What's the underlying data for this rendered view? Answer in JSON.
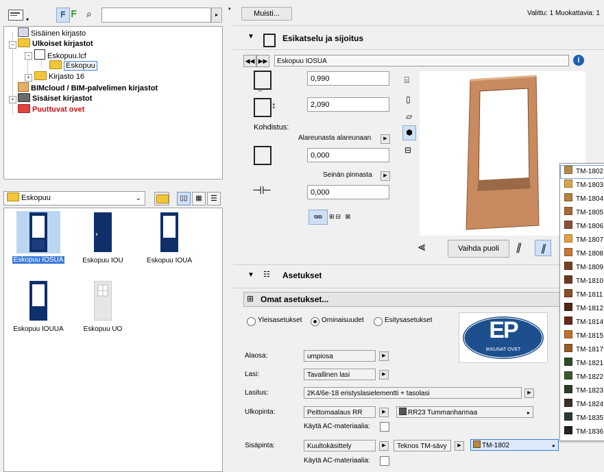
{
  "toolbar": {
    "search_placeholder": "",
    "muisti_button": "Muisti...",
    "status_text": "Valittu: 1 Muokattavia: 1"
  },
  "tree": {
    "items": [
      {
        "label": "Sisäinen kirjasto"
      },
      {
        "label": "Ulkoiset kirjastot"
      },
      {
        "label": "Eskopuu.lcf"
      },
      {
        "label": "Eskopuu"
      },
      {
        "label": "Kirjasto 16"
      },
      {
        "label": "BIMcloud / BIM-palvelimen kirjastot"
      },
      {
        "label": "Sisäiset kirjastot"
      },
      {
        "label": "Puuttuvat ovet"
      }
    ]
  },
  "folder_dropdown": {
    "value": "Eskopuu"
  },
  "thumbnails": [
    {
      "label": "Eskopuu IOSUA"
    },
    {
      "label": "Eskopuu IOU"
    },
    {
      "label": "Eskopuu IOUA"
    },
    {
      "label": "Eskopuu IOUUA"
    },
    {
      "label": "Eskopuu UO"
    }
  ],
  "preview": {
    "section_title": "Esikatselu ja sijoitus",
    "object_name": "Eskopuu IOSUA",
    "width": "0,990",
    "height": "2,090",
    "kohdistus_label": "Kohdistus:",
    "anchor_label": "Alareunasta alareunaan",
    "anchor_value": "0,000",
    "wall_label": "Seinän pinnasta",
    "wall_value": "0,000",
    "flip_button": "Vaihda puoli"
  },
  "settings": {
    "section_title": "Asetukset",
    "own_settings": "Omat asetukset...",
    "radios": [
      {
        "label": "Yleisasetukset",
        "checked": false
      },
      {
        "label": "Ominaisuudet",
        "checked": true
      },
      {
        "label": "Esitysasetukset",
        "checked": false
      }
    ],
    "logo_text": "EP",
    "logo_sub": "IKKUNAT OVET",
    "rows": {
      "alaosa_label": "Alaosa:",
      "alaosa_value": "umpiosa",
      "lasi_label": "Lasi:",
      "lasi_value": "Tavallinen lasi",
      "lasitus_label": "Lasitus:",
      "lasitus_value": "2K4/6e-18 eristyslasielementti + tasolasi",
      "ulkopinta_label": "Ulkopinta:",
      "ulkopinta_value": "Peittomaalaus RR",
      "ulkopinta_color": "RR23 Tummanharmaa",
      "use_ac_label_1": "Käytä AC-materiaalia:",
      "sisapinta_label": "Sisäpinta:",
      "sisapinta_value": "Kuultokäsittely",
      "sisapinta_type": "Teknos TM-sävy",
      "sisapinta_color": "TM-1802",
      "use_ac_label_2": "Käytä AC-materiaalia:"
    }
  },
  "color_popup": [
    {
      "code": "TM-1802",
      "color": "#b88a4a"
    },
    {
      "code": "TM-1803",
      "color": "#d8a44a"
    },
    {
      "code": "TM-1804",
      "color": "#b9813e"
    },
    {
      "code": "TM-1805",
      "color": "#a8693a"
    },
    {
      "code": "TM-1806",
      "color": "#8a5030"
    },
    {
      "code": "TM-1807",
      "color": "#e6a040"
    },
    {
      "code": "TM-1808",
      "color": "#c87a34"
    },
    {
      "code": "TM-1809",
      "color": "#7a4020"
    },
    {
      "code": "TM-1810",
      "color": "#6e3a1e"
    },
    {
      "code": "TM-1811",
      "color": "#8c4e28"
    },
    {
      "code": "TM-1812",
      "color": "#4e2818"
    },
    {
      "code": "TM-1814",
      "color": "#6a2a1a"
    },
    {
      "code": "TM-1815",
      "color": "#c0702c"
    },
    {
      "code": "TM-1817",
      "color": "#9a5a24"
    },
    {
      "code": "TM-1821",
      "color": "#2e4a26"
    },
    {
      "code": "TM-1822",
      "color": "#3a5a2c"
    },
    {
      "code": "TM-1823",
      "color": "#2c3e26"
    },
    {
      "code": "TM-1824",
      "color": "#3c2e24"
    },
    {
      "code": "TM-1835",
      "color": "#2a3a3a"
    },
    {
      "code": "TM-1836",
      "color": "#1e2224"
    }
  ]
}
